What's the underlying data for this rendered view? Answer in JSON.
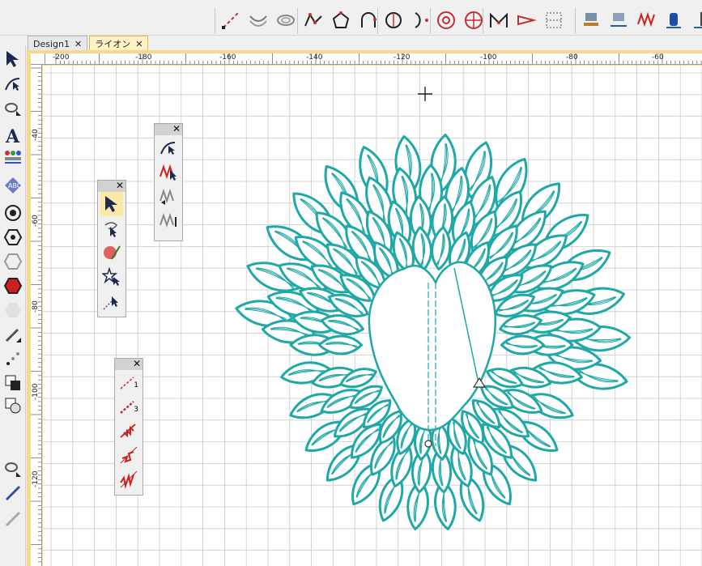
{
  "tabs": [
    {
      "label": "Design1",
      "close": "✕"
    },
    {
      "label": "ライオン",
      "close": "✕"
    }
  ],
  "ruler": {
    "h_labels": [
      "-200",
      "-180",
      "-160",
      "-140",
      "-120",
      "-100",
      "-80",
      "-60"
    ],
    "v_labels": [
      "-40",
      "-60",
      "-80",
      "-100",
      "-120"
    ]
  },
  "palettes": {
    "stitch_types": {
      "close": "✕"
    },
    "select_tools": {
      "close": "✕"
    },
    "stitch_lines": {
      "close": "✕",
      "label_one": "1",
      "label_three": "3"
    }
  },
  "colors": {
    "thread": "#1fa8a6",
    "tab_active": "#fff3c6",
    "frame": "#f6d98c",
    "selection": "#fde9a7"
  },
  "icons": {
    "toolbar": [
      "line-tool-icon",
      "arc-curve-icon",
      "ring-icon",
      "node-polygon-icon",
      "node-shape-icon",
      "arc-node-icon",
      "circle-node-icon",
      "half-circle-node-icon",
      "mandala-icon",
      "wheel-icon",
      "stitch-path-icon",
      "arrow-stitch-icon",
      "grid-stitch-icon",
      "machine-tool-icon",
      "machine-tool-2-icon",
      "zigzag-icon",
      "spool-icon",
      "needle-tool-icon"
    ],
    "toolbox": [
      "select-arrow-icon",
      "edit-node-icon",
      "morph-icon",
      "text-icon",
      "people-icon",
      "monogram-icon",
      "circle-icon",
      "hexagon-icon",
      "spiral-icon",
      "red-hexagon-icon",
      "hex-outline-icon",
      "pencil-icon",
      "node-tool-icon",
      "fill-icon",
      "shape-combine-icon",
      "morph-2-icon",
      "pen-icon",
      "knife-icon"
    ]
  }
}
